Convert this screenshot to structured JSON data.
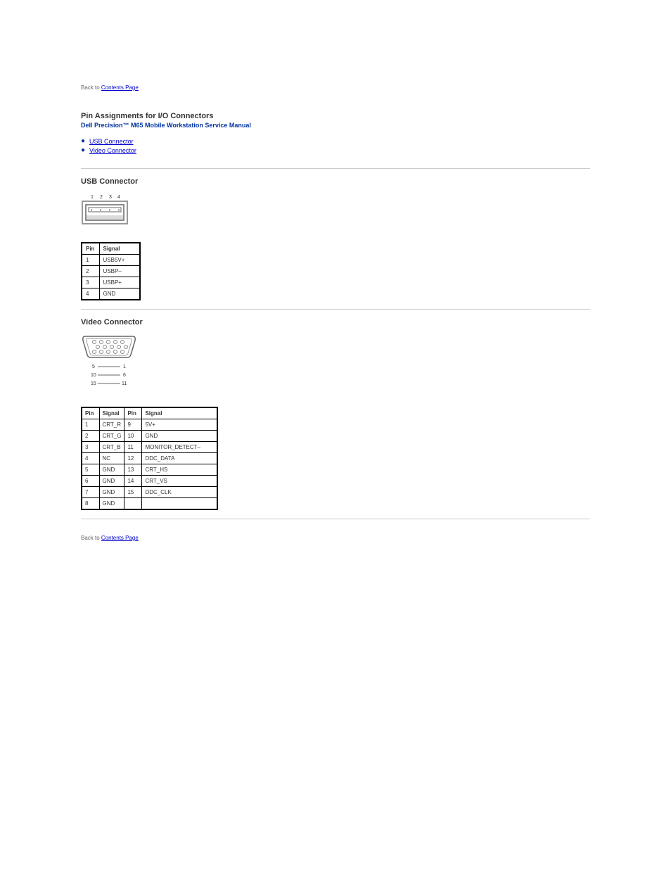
{
  "nav": {
    "back_prefix": "Back to ",
    "back_link": "Contents Page"
  },
  "header": {
    "title": "Pin Assignments for I/O Connectors",
    "subtitle": "Dell Precision™ M65 Mobile Workstation Service Manual"
  },
  "toc": {
    "items": [
      {
        "label": "USB Connector"
      },
      {
        "label": "Video Connector"
      }
    ]
  },
  "usb": {
    "title": "USB Connector",
    "headers": [
      "Pin",
      "Signal"
    ],
    "rows": [
      [
        "1",
        "USB5V+"
      ],
      [
        "2",
        "USBP–"
      ],
      [
        "3",
        "USBP+"
      ],
      [
        "4",
        "GND"
      ]
    ]
  },
  "video": {
    "title": "Video Connector",
    "headers": [
      "Pin",
      "Signal",
      "Pin",
      "Signal"
    ],
    "rows": [
      [
        "1",
        "CRT_R",
        "9",
        "5V+"
      ],
      [
        "2",
        "CRT_G",
        "10",
        "GND"
      ],
      [
        "3",
        "CRT_B",
        "11",
        "MONITOR_DETECT–"
      ],
      [
        "4",
        "NC",
        "12",
        "DDC_DATA"
      ],
      [
        "5",
        "GND",
        "13",
        "CRT_HS"
      ],
      [
        "6",
        "GND",
        "14",
        "CRT_VS"
      ],
      [
        "7",
        "GND",
        "15",
        "DDC_CLK"
      ],
      [
        "8",
        "GND",
        " ",
        " "
      ]
    ]
  }
}
